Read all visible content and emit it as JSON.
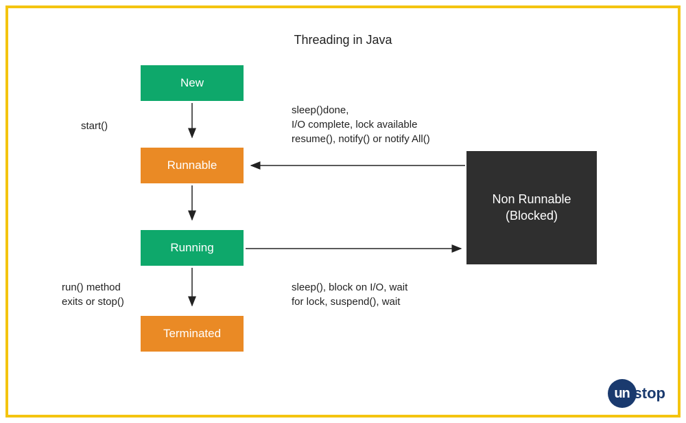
{
  "title": "Threading in Java",
  "states": {
    "new": "New",
    "runnable": "Runnable",
    "running": "Running",
    "terminated": "Terminated",
    "nonRunnable": "Non Runnable\n(Blocked)"
  },
  "labels": {
    "start": "start()",
    "resumeConditions": "sleep()done,\nI/O complete, lock available\nresume(), notify() or notify All()",
    "runExit": "run() method\nexits or stop()",
    "blockConditions": "sleep(), block on I/O, wait\nfor lock, suspend(), wait"
  },
  "logo": {
    "circle": "un",
    "text": "stop"
  },
  "colors": {
    "green": "#0ea86b",
    "orange": "#ea8a25",
    "dark": "#2f2f2f",
    "border": "#f4c40f"
  }
}
